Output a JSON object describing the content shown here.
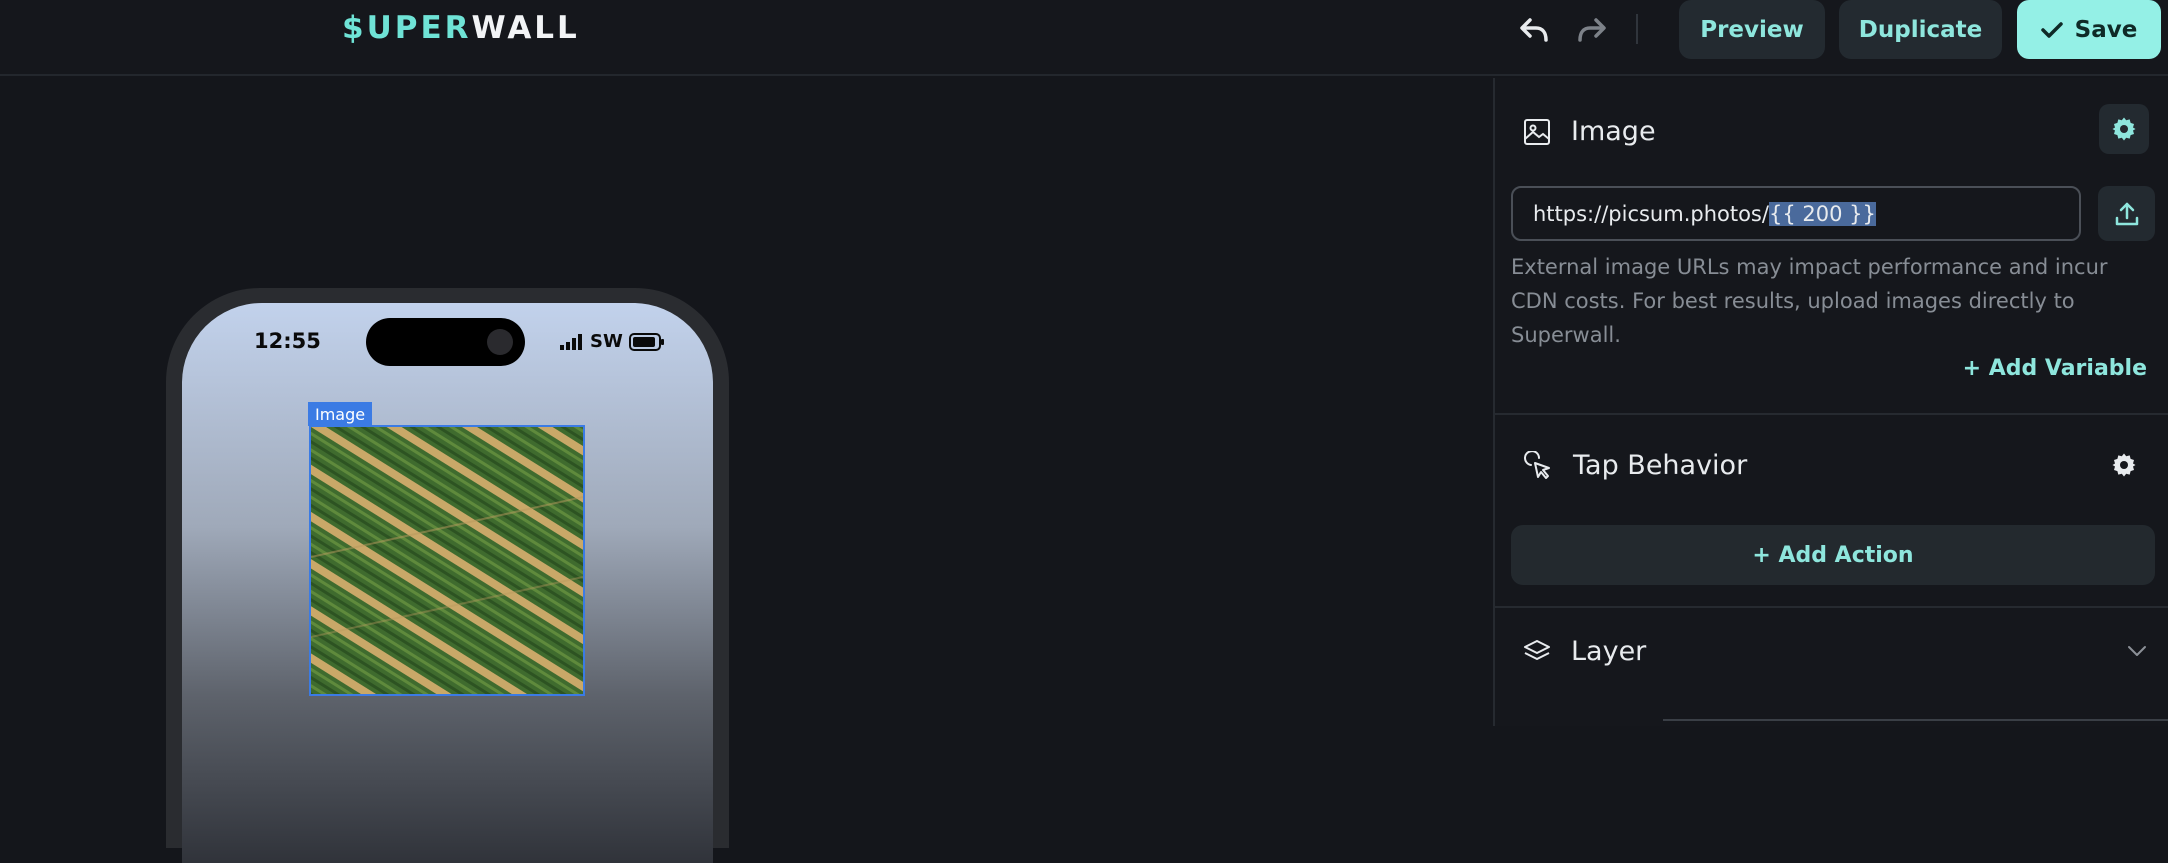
{
  "topbar": {
    "logo_part1": "$UPER",
    "logo_part2": "WALL",
    "preview_label": "Preview",
    "duplicate_label": "Duplicate",
    "save_label": "Save"
  },
  "phone": {
    "time": "12:55",
    "carrier": "SW",
    "selected_label": "Image"
  },
  "panel": {
    "image": {
      "title": "Image",
      "url_prefix": "https://picsum.photos/",
      "url_variable": "{{ 200 }}",
      "hint": "External image URLs may impact performance and incur CDN costs. For best results, upload images directly to Superwall.",
      "add_variable": "+ Add Variable"
    },
    "tap": {
      "title": "Tap Behavior",
      "add_action": "+ Add Action"
    },
    "layer": {
      "title": "Layer"
    }
  },
  "colors": {
    "accent": "#8ee6dd",
    "save_bg": "#94f0e6",
    "selection": "#3b7be4",
    "background": "#14161b"
  }
}
